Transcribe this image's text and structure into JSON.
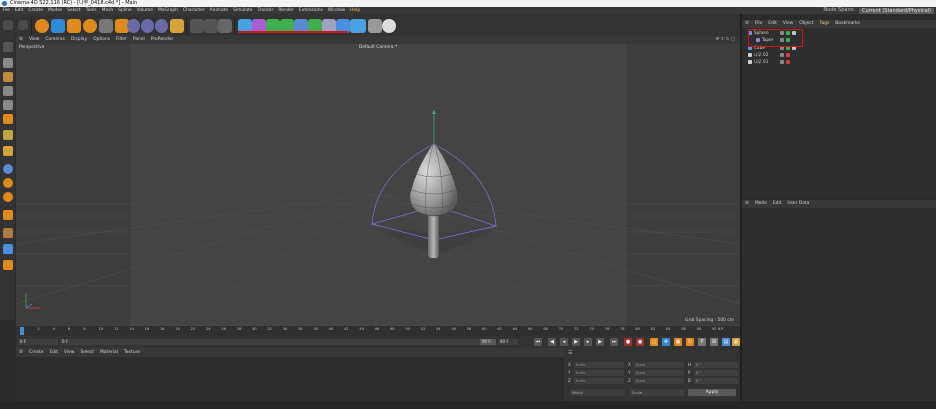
{
  "window": {
    "title": "Cinema 4D S22.116 (RC) - [나무_0418.c4d *] - Main"
  },
  "menu": {
    "items": [
      "File",
      "Edit",
      "Create",
      "Modes",
      "Select",
      "Tools",
      "Mesh",
      "Spline",
      "Volume",
      "MoGraph",
      "Character",
      "Animate",
      "Simulate",
      "Tracker",
      "Render",
      "Extensions",
      "Window",
      "Help"
    ],
    "highlighted_index": 17,
    "node_space_label": "Node Space:",
    "node_space_value": "Current (Standard/Physical)"
  },
  "viewport_menu": [
    "View",
    "Cameras",
    "Display",
    "Options",
    "Filter",
    "Panel",
    "ProRender"
  ],
  "viewport": {
    "name": "Perspective",
    "camera": "Default Camera:*",
    "grid_spacing": "Grid Spacing : 500 cm"
  },
  "timeline": {
    "ticks": [
      "0",
      "2",
      "4",
      "6",
      "8",
      "10",
      "12",
      "14",
      "16",
      "18",
      "20",
      "22",
      "24",
      "26",
      "28",
      "30",
      "32",
      "34",
      "36",
      "38",
      "40",
      "42",
      "44",
      "46",
      "48",
      "50",
      "52",
      "54",
      "56",
      "58",
      "60",
      "62",
      "64",
      "66",
      "68",
      "70",
      "72",
      "74",
      "76",
      "78",
      "80",
      "82",
      "84",
      "86",
      "88",
      "90"
    ],
    "current_frame_right": "0 F",
    "start_frame": "0 F",
    "preview_start": "0 F",
    "preview_end": "90 F",
    "end_frame": "90 F"
  },
  "material_menu": [
    "Create",
    "Edit",
    "View",
    "Select",
    "Material",
    "Texture"
  ],
  "coords": {
    "rows": [
      {
        "a_label": "X",
        "a_val": "0 cm",
        "b_label": "X",
        "b_val": "0 cm",
        "c_label": "H",
        "c_val": "0 °"
      },
      {
        "a_label": "Y",
        "a_val": "0 cm",
        "b_label": "Y",
        "b_val": "0 cm",
        "c_label": "P",
        "c_val": "0 °"
      },
      {
        "a_label": "Z",
        "a_val": "0 cm",
        "b_label": "Z",
        "b_val": "0 cm",
        "c_label": "B",
        "c_val": "0 °"
      }
    ],
    "mode1": "World",
    "mode2": "Scale",
    "apply": "Apply"
  },
  "object_menu": [
    "File",
    "Edit",
    "View",
    "Object",
    "Tags",
    "Bookmarks"
  ],
  "object_menu_highlight": 4,
  "objects": [
    {
      "name": "Sphere",
      "indent": 0,
      "color": "#5aa0e6"
    },
    {
      "name": "Taper",
      "indent": 1,
      "color": "#a07ad6"
    },
    {
      "name": "Cube",
      "indent": 0,
      "color": "#5aa0e6"
    },
    {
      "name": "나무 02",
      "indent": 0,
      "color": "#cfcfcf"
    },
    {
      "name": "나무 01",
      "indent": 0,
      "color": "#cfcfcf"
    }
  ],
  "attr_menu": [
    "Mode",
    "Edit",
    "User Data"
  ],
  "colors": {
    "accent_red": "#d0141c",
    "highlight_yellow": "#f0d060",
    "toolbar_bg": "#333333"
  }
}
